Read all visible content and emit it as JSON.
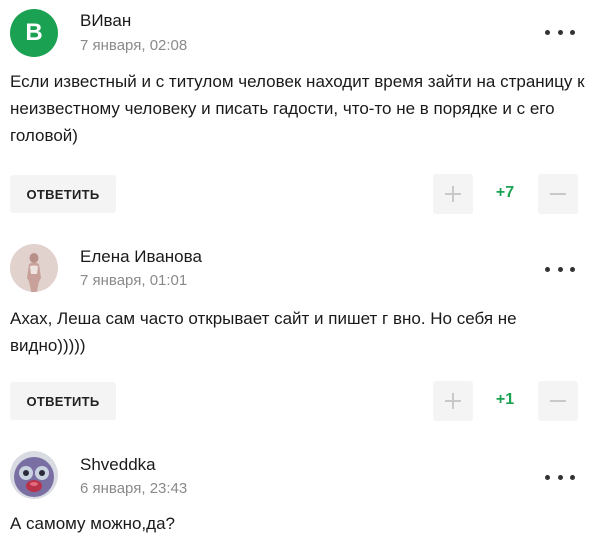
{
  "comments": [
    {
      "author": "ВИван",
      "avatar_letter": "В",
      "date": "7 января, 02:08",
      "text": "Если известный и с титулом человек находит время зайти на страницу к неизвестному человеку и писать гадости, что-то не в порядке и с его головой)",
      "reply_label": "ОТВЕТИТЬ",
      "score": "+7"
    },
    {
      "author": "Елена Иванова",
      "date": "7 января, 01:01",
      "text": "Ахах, Леша сам часто открывает сайт и пишет г  вно. Но себя не видно)))))",
      "reply_label": "ОТВЕТИТЬ",
      "score": "+1"
    },
    {
      "author": "Shveddka",
      "date": "6 января, 23:43",
      "text": "А самому можно,да?"
    }
  ],
  "colors": {
    "accent_green": "#1ba152",
    "button_bg": "#f4f4f4",
    "date_gray": "#8a8a8a"
  },
  "icons": [
    "more-icon",
    "plus-icon",
    "minus-icon"
  ]
}
